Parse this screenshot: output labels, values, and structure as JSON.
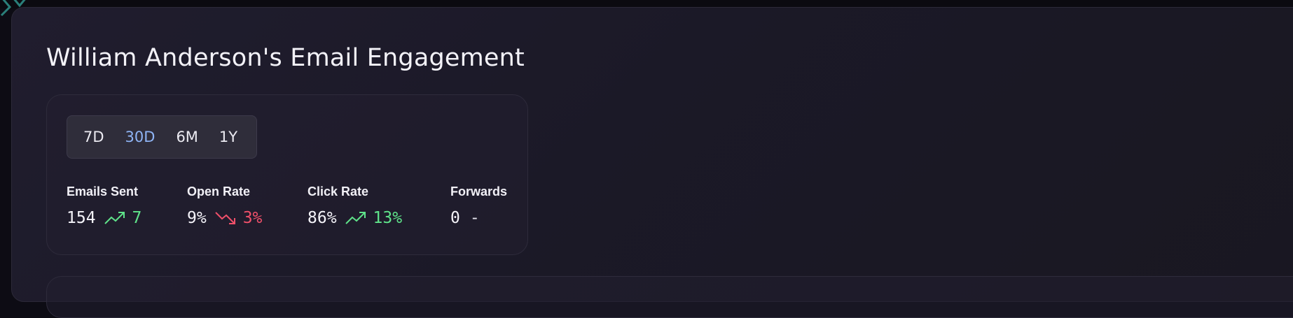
{
  "header": {
    "title": "William Anderson's Email Engagement"
  },
  "range_tabs": {
    "options": [
      "7D",
      "30D",
      "6M",
      "1Y"
    ],
    "selected": "30D"
  },
  "metrics": [
    {
      "label": "Emails Sent",
      "value": "154",
      "trend": "up",
      "delta": "7"
    },
    {
      "label": "Open Rate",
      "value": "9%",
      "trend": "down",
      "delta": "3%"
    },
    {
      "label": "Click Rate",
      "value": "86%",
      "trend": "up",
      "delta": "13%"
    },
    {
      "label": "Forwards",
      "value": "0",
      "trend": "none",
      "delta": "-"
    }
  ],
  "colors": {
    "positive": "#5fe38a",
    "negative": "#f0506a",
    "tab_active": "#8fb4f5",
    "logo_accent": "#2a7f7a"
  },
  "icons": {
    "trend_up": "trending-up-icon",
    "trend_down": "trending-down-icon",
    "logo": "logo-icon"
  }
}
